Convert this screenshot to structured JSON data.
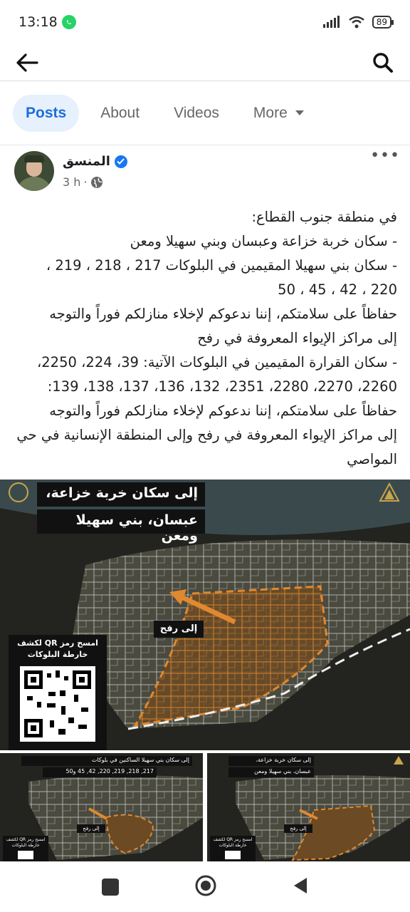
{
  "status_bar": {
    "time": "13:18",
    "battery": "89"
  },
  "header": {
    "back_icon": "arrow-left-icon",
    "search_icon": "search-icon"
  },
  "tabs": [
    {
      "label": "Posts",
      "active": true
    },
    {
      "label": "About",
      "active": false
    },
    {
      "label": "Videos",
      "active": false
    },
    {
      "label": "More",
      "active": false
    }
  ],
  "post": {
    "author": "المنسق",
    "time": "3 h",
    "lines": [
      "في منطقة جنوب القطاع:",
      "- سكان خربة خزاعة وعبسان وبني سهيلا ومعن",
      "- سكان بني سهيلا المقيمين في البلوكات 217 ، 218 ، 219 ،",
      "220 ، 42 ، 45 ، 50",
      "حفاظاً على سلامتكم، إننا ندعوكم لإخلاء منازلكم فوراً والتوجه",
      "إلى مراكز الإيواء المعروفة في رفح",
      "- سكان القرارة المقيمين في البلوكات الآتية: 39، 224، 2250،",
      "2260، 2270، 2280، 2351، 132، 136، 137، 138، 139:",
      "حفاظاً على سلامتكم، إننا ندعوكم لإخلاء منازلكم فوراً والتوجه",
      "إلى مراكز الإيواء المعروفة في رفح وإلى المنطقة الإنسانية في حي",
      "المواصي"
    ]
  },
  "main_image": {
    "title_line1": "إلى سكان خربة خزاعة،",
    "title_line2": "عبسان، بني سهيلا ومعن",
    "arrow_label": "إلى رفح",
    "qr_caption": "امسح رمز QR لكشف خارطة البلوكات"
  },
  "thumb_left": {
    "title_line1": "إلى سكان بني سهيلا الساكنين في بلوكات",
    "title_line2": "217, 218, 219, 220, 42, 45 و50",
    "arrow_label": "إلى رفح",
    "qr_caption": "امسح رمز QR لكشف خارطة البلوكات"
  },
  "thumb_right": {
    "title_line1": "إلى سكان خربة خزاعة،",
    "title_line2": "عبسان، بني سهيلا ومعن",
    "arrow_label": "إلى رفح",
    "qr_caption": "امسح رمز QR لكشف خارطة البلوكات"
  },
  "colors": {
    "accent": "#1b6fd9",
    "zone": "#e0892e",
    "map_bg": "#2a2b26"
  }
}
